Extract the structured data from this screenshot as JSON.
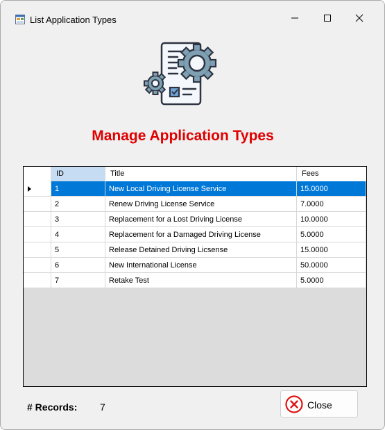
{
  "window": {
    "title": "List Application Types",
    "icons": {
      "app": "form-icon",
      "minimize": "minimize-icon",
      "maximize": "maximize-icon",
      "close": "close-icon"
    }
  },
  "header": {
    "logo_icon": "document-gears-icon",
    "title": "Manage Application Types",
    "title_color": "#e00000"
  },
  "grid": {
    "columns": [
      "ID",
      "Title",
      "Fees"
    ],
    "selected_row_index": 0,
    "selection_color": "#0078d7",
    "rows": [
      {
        "id": "1",
        "title": "New Local Driving License Service",
        "fees": "15.0000"
      },
      {
        "id": "2",
        "title": "Renew Driving License Service",
        "fees": "7.0000"
      },
      {
        "id": "3",
        "title": "Replacement for a Lost Driving License",
        "fees": "10.0000"
      },
      {
        "id": "4",
        "title": "Replacement for a Damaged Driving License",
        "fees": "5.0000"
      },
      {
        "id": "5",
        "title": "Release Detained Driving Licsense",
        "fees": "15.0000"
      },
      {
        "id": "6",
        "title": "New International License",
        "fees": "50.0000"
      },
      {
        "id": "7",
        "title": "Retake Test",
        "fees": "5.0000"
      }
    ]
  },
  "footer": {
    "records_label": "# Records:",
    "records_count": "7",
    "close_label": "Close",
    "close_icon": "close-circle-icon"
  }
}
